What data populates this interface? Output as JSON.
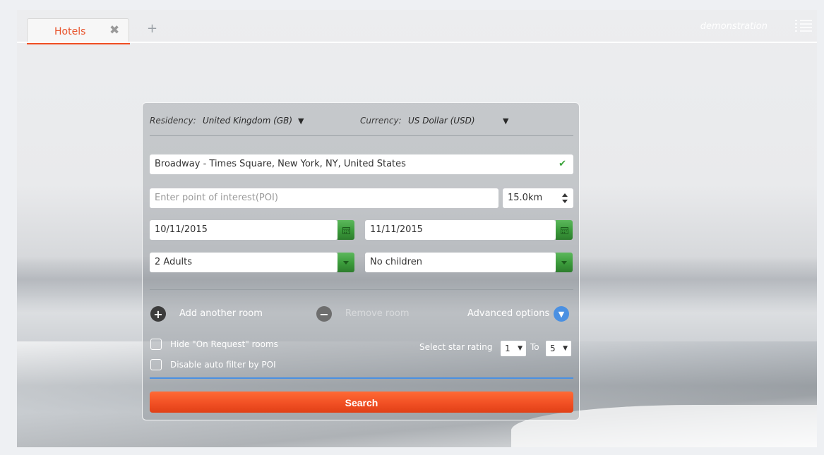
{
  "tabs": {
    "active_label": "Hotels",
    "close_symbol": "✖",
    "add_symbol": "+"
  },
  "header": {
    "brand": "demonstration",
    "menu_icon": "list-menu-icon"
  },
  "form": {
    "residency_label": "Residency:",
    "residency_value": "United Kingdom (GB)",
    "currency_label": "Currency:",
    "currency_value": "US Dollar (USD)",
    "dropdown_arrow": "▼",
    "destination_value": "Broadway - Times Square, New York, NY, United States",
    "destination_valid_icon": "✔",
    "poi_placeholder": "Enter point of interest(POI)",
    "radius_value": "15.0km",
    "checkin_date": "10/11/2015",
    "checkout_date": "11/11/2015",
    "adults_value": "2 Adults",
    "children_value": "No children",
    "add_room_label": "Add another room",
    "remove_room_label": "Remove room",
    "advanced_options_label": "Advanced options",
    "hide_on_request_label": "Hide \"On Request\" rooms",
    "disable_auto_filter_label": "Disable auto filter by POI",
    "star_rating_label": "Select star rating",
    "star_from": "1",
    "star_to_label": "To",
    "star_to": "5",
    "search_label": "Search"
  },
  "colors": {
    "accent": "#f04e23",
    "green": "#3a9a3a",
    "blue": "#4a90e2"
  }
}
